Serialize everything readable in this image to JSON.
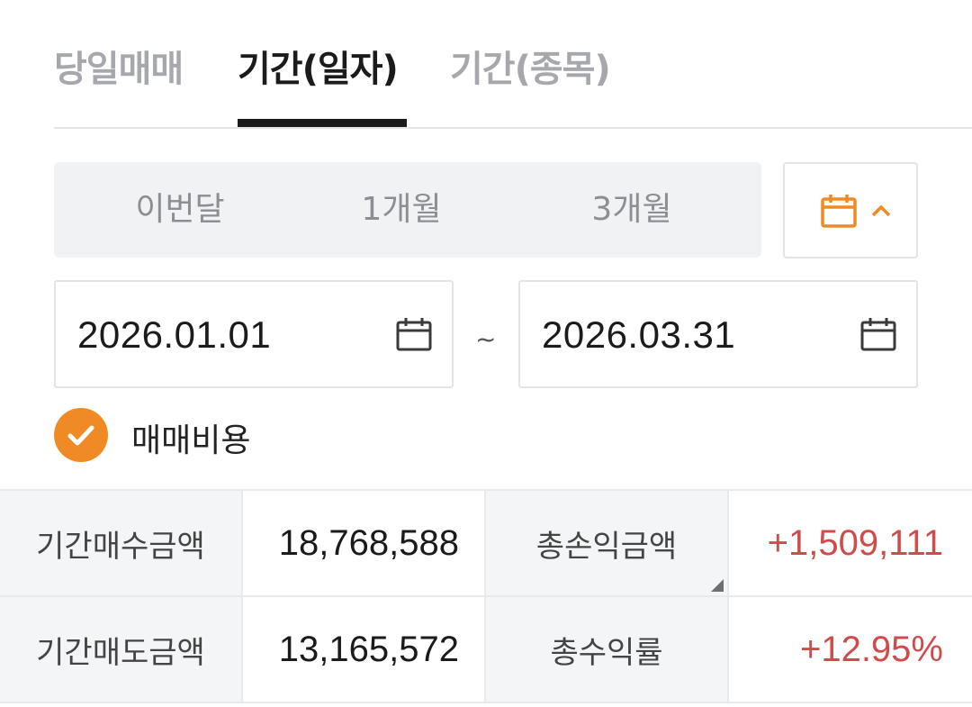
{
  "tabs": [
    {
      "label": "당일매매"
    },
    {
      "label": "기간(일자)"
    },
    {
      "label": "기간(종목)"
    }
  ],
  "period": {
    "buttons": [
      {
        "label": "이번달"
      },
      {
        "label": "1개월"
      },
      {
        "label": "3개월"
      }
    ],
    "calendar_toggle_icon": "calendar-icon",
    "calendar_toggle_chevron": "chevron-up-icon"
  },
  "dates": {
    "start": "2026.01.01",
    "separator": "~",
    "end": "2026.03.31"
  },
  "options": {
    "trading_cost_label": "매매비용",
    "trading_cost_checked": true
  },
  "summary": {
    "period_buy_label": "기간매수금액",
    "period_buy_value": "18,768,588",
    "total_pnl_label": "총손익금액",
    "total_pnl_value": "+1,509,111",
    "period_sell_label": "기간매도금액",
    "period_sell_value": "13,165,572",
    "total_return_label": "총수익률",
    "total_return_value": "+12.95%"
  },
  "colors": {
    "accent": "#f08a24",
    "positive": "#d24b4b",
    "active_tab": "#1b1b1b",
    "inactive_tab": "#a6a8ad"
  }
}
